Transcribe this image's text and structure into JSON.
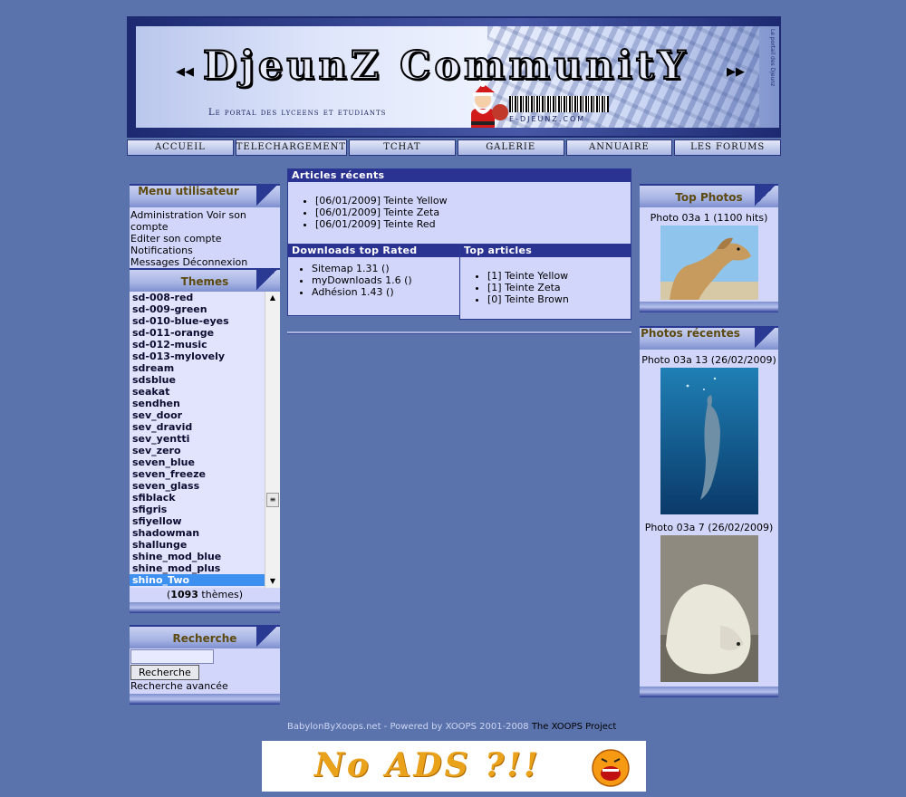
{
  "banner": {
    "title": "DjeunZ CommunitY",
    "subtitle": "Le portal des lyceens et etudiants",
    "url": "E-DJEUNZ.COM",
    "side_text": "Le portail des Djeunz"
  },
  "nav": [
    "ACCUEIL",
    "TELECHARGEMENT",
    "TCHAT",
    "GALERIE",
    "ANNUAIRE",
    "LES FORUMS"
  ],
  "user_menu": {
    "title": "Menu utilisateur",
    "links": [
      "Administration",
      "Voir son compte",
      "Editer son compte",
      "Notifications",
      "Messages",
      "Déconnexion"
    ]
  },
  "themes": {
    "title": "Themes",
    "items": [
      "sd-008-red",
      "sd-009-green",
      "sd-010-blue-eyes",
      "sd-011-orange",
      "sd-012-music",
      "sd-013-mylovely",
      "sdream",
      "sdsblue",
      "seakat",
      "sendhen",
      "sev_door",
      "sev_dravid",
      "sev_yentti",
      "sev_zero",
      "seven_blue",
      "seven_freeze",
      "seven_glass",
      "sfiblack",
      "sfigris",
      "sfiyellow",
      "shadowman",
      "shallunge",
      "shine_mod_blue",
      "shine_mod_plus",
      "shino_Two"
    ],
    "selected": "shino_Two",
    "count": "1093",
    "count_suffix": "thèmes"
  },
  "search": {
    "title": "Recherche",
    "input_value": "",
    "button_label": "Recherche",
    "advanced_label": "Recherche avancée"
  },
  "articles_recents": {
    "title": "Articles récents",
    "items": [
      "[06/01/2009] Teinte Yellow",
      "[06/01/2009] Teinte Zeta",
      "[06/01/2009] Teinte Red"
    ]
  },
  "downloads_top": {
    "title": "Downloads top Rated",
    "items": [
      "Sitemap 1.31  ()",
      "myDownloads 1.6  ()",
      "Adhésion 1.43  ()"
    ]
  },
  "top_articles": {
    "title": "Top articles",
    "items": [
      "[1] Teinte Yellow",
      "[1] Teinte Zeta",
      "[0] Teinte Brown"
    ]
  },
  "top_photos": {
    "title": "Top Photos",
    "caption": "Photo 03a 1 (1100 hits)"
  },
  "recent_photos": {
    "title": "Photos récentes",
    "items": [
      {
        "caption": "Photo 03a 13 (26/02/2009)"
      },
      {
        "caption": "Photo 03a 7 (26/02/2009)"
      }
    ]
  },
  "footer": {
    "text": "BabylonByXoops.net - Powered by XOOPS 2001-2008",
    "project_link": "The XOOPS Project"
  },
  "ads": {
    "text": "No ADS ?!!"
  }
}
